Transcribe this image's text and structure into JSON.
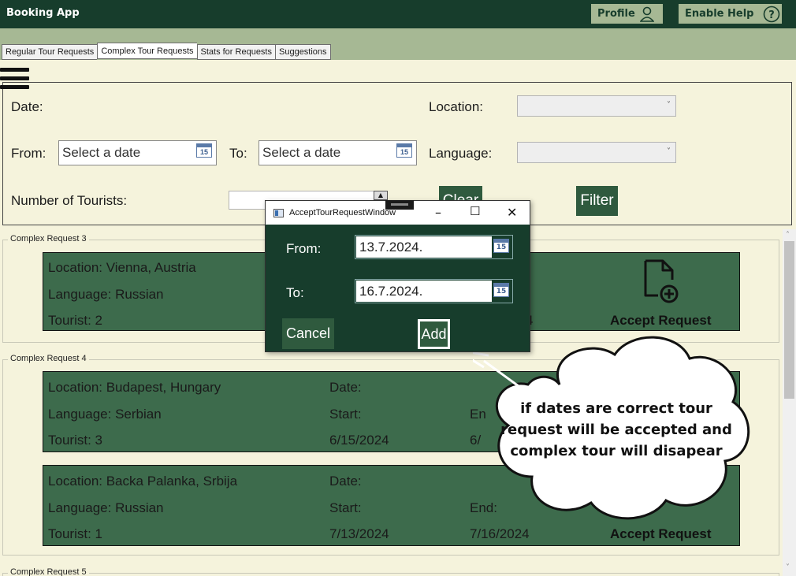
{
  "app": {
    "title": "Booking App"
  },
  "header": {
    "profile_label": "Profile",
    "help_label": "Enable Help"
  },
  "tabs": [
    {
      "label": "Regular Tour Requests",
      "active": false
    },
    {
      "label": "Complex Tour Requests",
      "active": true
    },
    {
      "label": "Stats for Requests",
      "active": false
    },
    {
      "label": "Suggestions",
      "active": false
    }
  ],
  "filter": {
    "date_label": "Date:",
    "from_label": "From:",
    "from_placeholder": "Select a date",
    "to_label": "To:",
    "to_placeholder": "Select a date",
    "tourists_label": "Number of Tourists:",
    "location_label": "Location:",
    "language_label": "Language:",
    "clear_label": "Clear",
    "filter_label": "Filter",
    "calendar_day": "15"
  },
  "groups": [
    {
      "title": "Complex Request 3",
      "cards": [
        {
          "location": "Location: Vienna, Austria",
          "language": "Language: Russian",
          "tourist": "Tourist: 2",
          "end_date_fragment": "4",
          "accept_label": "Accept Request"
        }
      ]
    },
    {
      "title": "Complex Request 4",
      "cards": [
        {
          "location": "Location: Budapest, Hungary",
          "language": "Language: Serbian",
          "tourist": "Tourist: 3",
          "date_label": "Date:",
          "start_label": "Start:",
          "start_date": "6/15/2024",
          "end_label_fragment": "En",
          "end_date_fragment": "6/"
        },
        {
          "location": "Location: Backa Palanka, Srbija",
          "language": "Language: Russian",
          "tourist": "Tourist: 1",
          "date_label": "Date:",
          "start_label": "Start:",
          "start_date": "7/13/2024",
          "end_label": "End:",
          "end_date": "7/16/2024",
          "accept_label": "Accept Request"
        }
      ]
    },
    {
      "title": "Complex Request 5"
    }
  ],
  "dialog": {
    "title": "AcceptTourRequestWindow",
    "from_label": "From:",
    "from_value": "13.7.2024.",
    "to_label": "To:",
    "to_value": "16.7.2024.",
    "cancel_label": "Cancel",
    "add_label": "Add"
  },
  "callout": {
    "text": "if dates are correct tour request will be accepted and complex tour will disapear"
  },
  "colors": {
    "titlebar": "#173d2c",
    "strip": "#a6b894",
    "background": "#f5f3dc",
    "card": "#3d6b4c",
    "button": "#2f5a3e"
  }
}
